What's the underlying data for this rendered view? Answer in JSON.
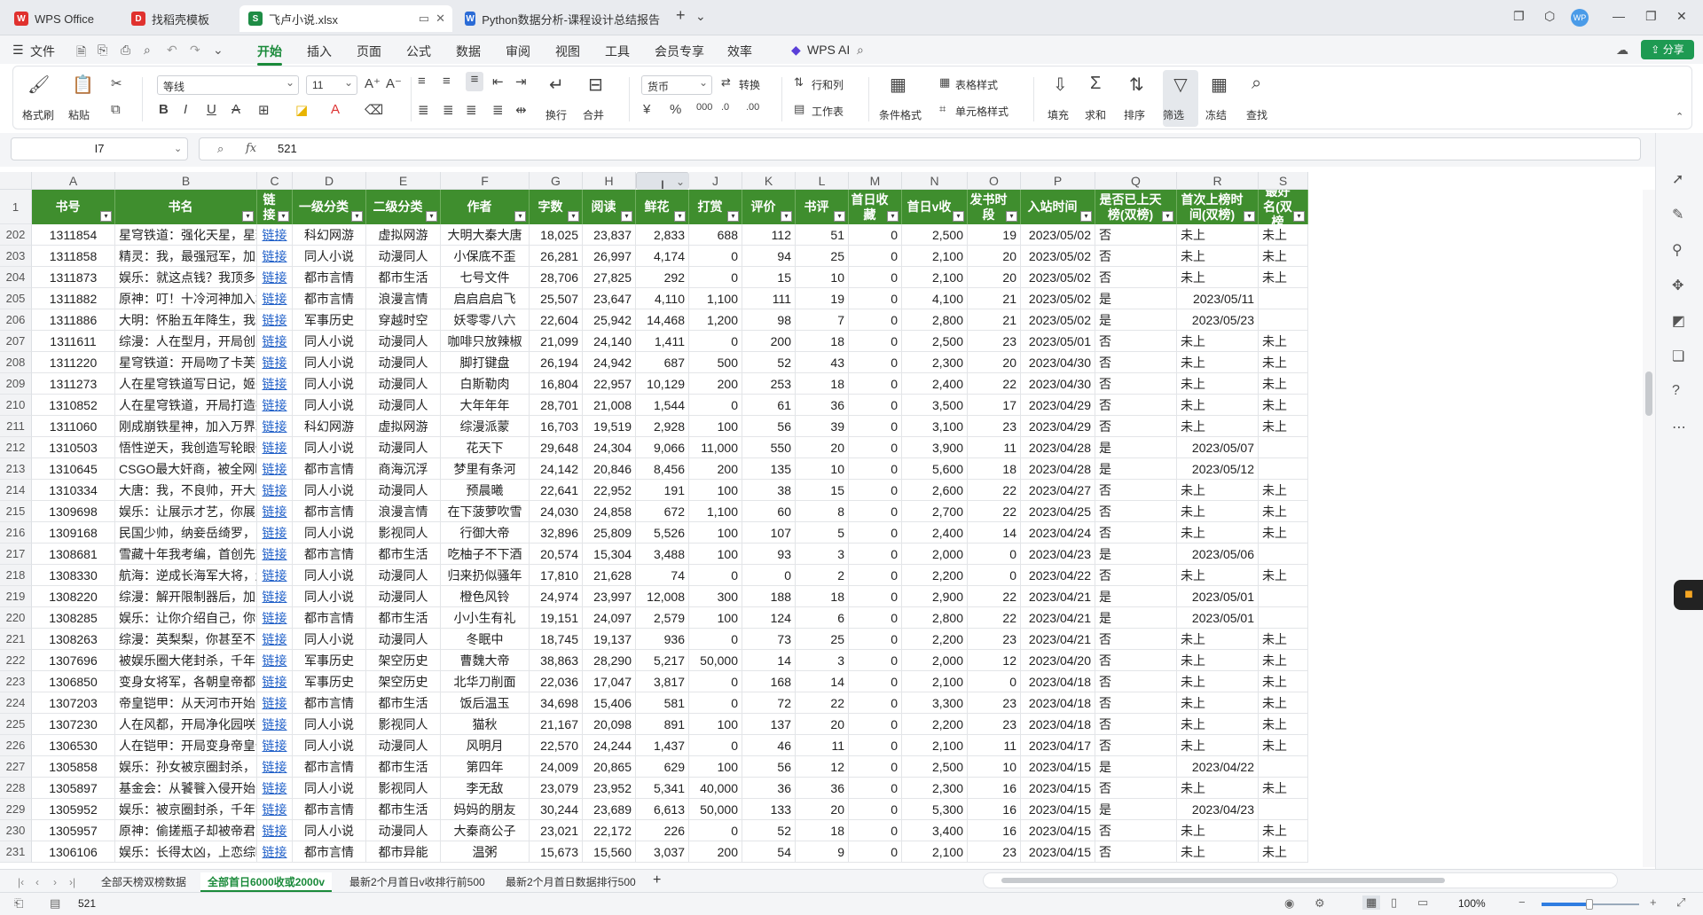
{
  "titlebar": {
    "tabs": [
      {
        "label": "WPS Office",
        "icon": "wps-logo-icon",
        "color": "#e0312e"
      },
      {
        "label": "找稻壳模板",
        "icon": "docer-icon",
        "color": "#e0312e"
      },
      {
        "label": "飞卢小说.xlsx",
        "icon": "spreadsheet-icon",
        "color": "#1e8c45"
      },
      {
        "label": "Python数据分析-课程设计总结报告",
        "icon": "writer-icon",
        "color": "#2b6bd6"
      }
    ],
    "user_avatar": "WP"
  },
  "menubar": {
    "file": "文件",
    "items": [
      "开始",
      "插入",
      "页面",
      "公式",
      "数据",
      "审阅",
      "视图",
      "工具",
      "会员专享",
      "效率"
    ],
    "wps_ai": "WPS AI",
    "share": "分享"
  },
  "ribbon": {
    "format_painter": "格式刷",
    "paste": "粘贴",
    "font_name": "等线",
    "font_size": "11",
    "wrap": "换行",
    "merge": "合并",
    "number_format": "货币",
    "convert": "转换",
    "row_col": "行和列",
    "worksheet": "工作表",
    "cond_format": "条件格式",
    "table_style": "表格样式",
    "cell_style": "单元格样式",
    "fill": "填充",
    "sum": "求和",
    "sort": "排序",
    "filter": "筛选",
    "freeze": "冻结",
    "find": "查找"
  },
  "formula_bar": {
    "cell_ref": "I7",
    "fx": "fx",
    "value": "521"
  },
  "columns": [
    "A",
    "B",
    "C",
    "D",
    "E",
    "F",
    "G",
    "H",
    "I",
    "J",
    "K",
    "L",
    "M",
    "N",
    "O",
    "P",
    "Q",
    "R",
    "S"
  ],
  "selected_column": "I",
  "headers": [
    "书号",
    "书名",
    "链接",
    "一级分类",
    "二级分类",
    "作者",
    "字数",
    "阅读",
    "鲜花",
    "打赏",
    "评价",
    "书评",
    "首日收藏",
    "首日v收",
    "发书时段",
    "入站时间",
    "是否已上天榜(双榜)",
    "首次上榜时间(双榜)",
    "最好名(双榜"
  ],
  "header_row_num": "1",
  "rows": [
    {
      "n": "202",
      "cells": [
        "1311854",
        "星穹铁道：强化天星，星球的星!",
        "链接",
        "科幻网游",
        "虚拟网游",
        "大明大秦大唐",
        "18,025",
        "23,837",
        "2,833",
        "688",
        "112",
        "51",
        "0",
        "2,500",
        "19",
        "2023/05/02",
        "否",
        "未上",
        "未上"
      ]
    },
    {
      "n": "203",
      "cells": [
        "1311858",
        "精灵：我，最强冠军，加入聊天群",
        "链接",
        "同人小说",
        "动漫同人",
        "小保底不歪",
        "26,281",
        "26,997",
        "4,174",
        "0",
        "94",
        "25",
        "0",
        "2,100",
        "20",
        "2023/05/02",
        "否",
        "未上",
        "未上"
      ]
    },
    {
      "n": "204",
      "cells": [
        "1311873",
        "娱乐：就这点钱？我顶多唱一宿!",
        "链接",
        "都市言情",
        "都市生活",
        "七号文件",
        "28,706",
        "27,825",
        "292",
        "0",
        "15",
        "10",
        "0",
        "2,100",
        "20",
        "2023/05/02",
        "否",
        "未上",
        "未上"
      ]
    },
    {
      "n": "205",
      "cells": [
        "1311882",
        "原神：叮！十冷河神加入群聊!",
        "链接",
        "都市言情",
        "浪漫言情",
        "启启启启飞",
        "25,507",
        "23,647",
        "4,110",
        "1,100",
        "111",
        "19",
        "0",
        "4,100",
        "21",
        "2023/05/02",
        "是",
        "2023/05/11",
        ""
      ]
    },
    {
      "n": "206",
      "cells": [
        "1311886",
        "大明：怀胎五年降生，我朱家恶龙",
        "链接",
        "军事历史",
        "穿越时空",
        "妖零零八六",
        "22,604",
        "25,942",
        "14,468",
        "1,200",
        "98",
        "7",
        "0",
        "2,800",
        "21",
        "2023/05/02",
        "是",
        "2023/05/23",
        ""
      ]
    },
    {
      "n": "207",
      "cells": [
        "1311611",
        "综漫：人在型月，开局创建聊天群",
        "链接",
        "同人小说",
        "动漫同人",
        "咖啡只放辣椒",
        "21,099",
        "24,140",
        "1,411",
        "0",
        "200",
        "18",
        "0",
        "2,500",
        "23",
        "2023/05/01",
        "否",
        "未上",
        "未上"
      ]
    },
    {
      "n": "208",
      "cells": [
        "1311220",
        "星穹铁道：开局吻了卡芙卡",
        "链接",
        "同人小说",
        "动漫同人",
        "脚打键盘",
        "26,194",
        "24,942",
        "687",
        "500",
        "52",
        "43",
        "0",
        "2,300",
        "20",
        "2023/04/30",
        "否",
        "未上",
        "未上"
      ]
    },
    {
      "n": "209",
      "cells": [
        "1311273",
        "人在星穹铁道写日记，姬子坏掉了",
        "链接",
        "同人小说",
        "动漫同人",
        "白斯勒肉",
        "16,804",
        "22,957",
        "10,129",
        "200",
        "253",
        "18",
        "0",
        "2,400",
        "22",
        "2023/04/30",
        "否",
        "未上",
        "未上"
      ]
    },
    {
      "n": "210",
      "cells": [
        "1310852",
        "人在星穹铁道，开局打造提瓦特",
        "链接",
        "同人小说",
        "动漫同人",
        "大年年年",
        "28,701",
        "21,008",
        "1,544",
        "0",
        "61",
        "36",
        "0",
        "3,500",
        "17",
        "2023/04/29",
        "否",
        "未上",
        "未上"
      ]
    },
    {
      "n": "211",
      "cells": [
        "1311060",
        "刚成崩铁星神，加入万界聊天群",
        "链接",
        "科幻网游",
        "虚拟网游",
        "综漫派蒙",
        "16,703",
        "19,519",
        "2,928",
        "100",
        "56",
        "39",
        "0",
        "3,100",
        "23",
        "2023/04/29",
        "否",
        "未上",
        "未上"
      ]
    },
    {
      "n": "212",
      "cells": [
        "1310503",
        "悟性逆天，我创造写轮眼修炼法",
        "链接",
        "同人小说",
        "动漫同人",
        "花天下",
        "29,648",
        "24,304",
        "9,066",
        "11,000",
        "550",
        "20",
        "0",
        "3,900",
        "11",
        "2023/04/28",
        "是",
        "2023/05/07",
        ""
      ]
    },
    {
      "n": "213",
      "cells": [
        "1310645",
        "CSGO最大奸商，被全网曝光",
        "链接",
        "都市言情",
        "商海沉浮",
        "梦里有条河",
        "24,142",
        "20,846",
        "8,456",
        "200",
        "135",
        "10",
        "0",
        "5,600",
        "18",
        "2023/04/28",
        "是",
        "2023/05/12",
        ""
      ]
    },
    {
      "n": "214",
      "cells": [
        "1310334",
        "大唐：我，不良帅，开大唐盛世!",
        "链接",
        "同人小说",
        "动漫同人",
        "预晨曦",
        "22,641",
        "22,952",
        "191",
        "100",
        "38",
        "15",
        "0",
        "2,600",
        "22",
        "2023/04/27",
        "否",
        "未上",
        "未上"
      ]
    },
    {
      "n": "215",
      "cells": [
        "1309698",
        "娱乐：让展示才艺，你展示财力?",
        "链接",
        "都市言情",
        "浪漫言情",
        "在下菠萝吹雪",
        "24,030",
        "24,858",
        "672",
        "1,100",
        "60",
        "8",
        "0",
        "2,700",
        "22",
        "2023/04/25",
        "否",
        "未上",
        "未上"
      ]
    },
    {
      "n": "216",
      "cells": [
        "1309168",
        "民国少帅，纳妾岳绮罗，多子多福",
        "链接",
        "同人小说",
        "影视同人",
        "行御大帝",
        "32,896",
        "25,809",
        "5,526",
        "100",
        "107",
        "5",
        "0",
        "2,400",
        "14",
        "2023/04/24",
        "否",
        "未上",
        "未上"
      ]
    },
    {
      "n": "217",
      "cells": [
        "1308681",
        "雪藏十年我考编，首创先斩娱乐圈",
        "链接",
        "都市言情",
        "都市生活",
        "吃柚子不下酒",
        "20,574",
        "15,304",
        "3,488",
        "100",
        "93",
        "3",
        "0",
        "2,000",
        "0",
        "2023/04/23",
        "是",
        "2023/05/06",
        ""
      ]
    },
    {
      "n": "218",
      "cells": [
        "1308330",
        "航海：逆成长海军大将，越老越强",
        "链接",
        "同人小说",
        "动漫同人",
        "归来扔似骚年",
        "17,810",
        "21,628",
        "74",
        "0",
        "0",
        "2",
        "0",
        "2,200",
        "0",
        "2023/04/22",
        "否",
        "未上",
        "未上"
      ]
    },
    {
      "n": "219",
      "cells": [
        "1308220",
        "综漫：解开限制器后，加入聊天群",
        "链接",
        "同人小说",
        "动漫同人",
        "橙色风铃",
        "24,974",
        "23,997",
        "12,008",
        "300",
        "188",
        "18",
        "0",
        "2,900",
        "22",
        "2023/04/21",
        "是",
        "2023/05/01",
        ""
      ]
    },
    {
      "n": "220",
      "cells": [
        "1308285",
        "娱乐：让你介绍自己，你介绍家底",
        "链接",
        "都市言情",
        "都市生活",
        "小小生有礼",
        "19,151",
        "24,097",
        "2,579",
        "100",
        "124",
        "6",
        "0",
        "2,800",
        "22",
        "2023/04/21",
        "是",
        "2023/05/01",
        ""
      ]
    },
    {
      "n": "221",
      "cells": [
        "1308263",
        "综漫：英梨梨，你甚至不肯叫我爸",
        "链接",
        "同人小说",
        "动漫同人",
        "冬眠中",
        "18,745",
        "19,137",
        "936",
        "0",
        "73",
        "25",
        "0",
        "2,200",
        "23",
        "2023/04/21",
        "否",
        "未上",
        "未上"
      ]
    },
    {
      "n": "222",
      "cells": [
        "1307696",
        "被娱乐圈大佬封杀，千年家族现世",
        "链接",
        "军事历史",
        "架空历史",
        "曹魏大帝",
        "38,863",
        "28,290",
        "5,217",
        "50,000",
        "14",
        "3",
        "0",
        "2,000",
        "12",
        "2023/04/20",
        "否",
        "未上",
        "未上"
      ]
    },
    {
      "n": "223",
      "cells": [
        "1306850",
        "变身女将军，各朝皇帝都暗恋我",
        "链接",
        "军事历史",
        "架空历史",
        "北华刀削面",
        "22,036",
        "17,047",
        "3,817",
        "0",
        "168",
        "14",
        "0",
        "2,100",
        "0",
        "2023/04/18",
        "否",
        "未上",
        "未上"
      ]
    },
    {
      "n": "224",
      "cells": [
        "1307203",
        "帝皇铠甲：从天河市开始曝光",
        "链接",
        "都市言情",
        "都市生活",
        "饭后温玉",
        "34,698",
        "15,406",
        "581",
        "0",
        "72",
        "22",
        "0",
        "3,300",
        "23",
        "2023/04/18",
        "否",
        "未上",
        "未上"
      ]
    },
    {
      "n": "225",
      "cells": [
        "1307230",
        "人在风都，开局净化园咲姐妹!",
        "链接",
        "同人小说",
        "影视同人",
        "猫秋",
        "21,167",
        "20,098",
        "891",
        "100",
        "137",
        "20",
        "0",
        "2,200",
        "23",
        "2023/04/18",
        "否",
        "未上",
        "未上"
      ]
    },
    {
      "n": "226",
      "cells": [
        "1306530",
        "人在铠甲：开局变身帝皇侠!",
        "链接",
        "同人小说",
        "动漫同人",
        "风明月",
        "22,570",
        "24,244",
        "1,437",
        "0",
        "46",
        "11",
        "0",
        "2,100",
        "11",
        "2023/04/17",
        "否",
        "未上",
        "未上"
      ]
    },
    {
      "n": "227",
      "cells": [
        "1305858",
        "娱乐：孙女被京圈封杀，家族被曝",
        "链接",
        "都市言情",
        "都市生活",
        "第四年",
        "24,009",
        "20,865",
        "629",
        "100",
        "56",
        "12",
        "0",
        "2,500",
        "10",
        "2023/04/15",
        "是",
        "2023/04/22",
        ""
      ]
    },
    {
      "n": "228",
      "cells": [
        "1305897",
        "基金会：从饕餮入侵开始曝光!",
        "链接",
        "同人小说",
        "影视同人",
        "李无敌",
        "23,079",
        "23,952",
        "5,341",
        "40,000",
        "36",
        "36",
        "0",
        "2,300",
        "16",
        "2023/04/15",
        "否",
        "未上",
        "未上"
      ]
    },
    {
      "n": "229",
      "cells": [
        "1305952",
        "娱乐：被京圈封杀，千年世家曝光",
        "链接",
        "都市言情",
        "都市生活",
        "妈妈的朋友",
        "30,244",
        "23,689",
        "6,613",
        "50,000",
        "133",
        "20",
        "0",
        "5,300",
        "16",
        "2023/04/15",
        "是",
        "2023/04/23",
        ""
      ]
    },
    {
      "n": "230",
      "cells": [
        "1305957",
        "原神：偷搓瓶子却被帝君当场抓包",
        "链接",
        "同人小说",
        "动漫同人",
        "大秦商公子",
        "23,021",
        "22,172",
        "226",
        "0",
        "52",
        "18",
        "0",
        "3,400",
        "16",
        "2023/04/15",
        "否",
        "未上",
        "未上"
      ]
    },
    {
      "n": "231",
      "cells": [
        "1306106",
        "娱乐：长得太凶，上恋综吓哭白露",
        "链接",
        "都市言情",
        "都市异能",
        "温粥",
        "15,673",
        "15,560",
        "3,037",
        "200",
        "54",
        "9",
        "0",
        "2,100",
        "23",
        "2023/04/15",
        "否",
        "未上",
        "未上"
      ]
    }
  ],
  "sheet_tabs": [
    "全部天榜双榜数据",
    "全部首日6000收或2000v",
    "最新2个月首日v收排行前500",
    "最新2个月首日数据排行500"
  ],
  "active_sheet": 1,
  "status": {
    "value": "521",
    "zoom": "100%"
  },
  "colors": {
    "header_green": "#3f8e2e",
    "accent": "#1a8a3a",
    "link": "#1f5fc8"
  }
}
